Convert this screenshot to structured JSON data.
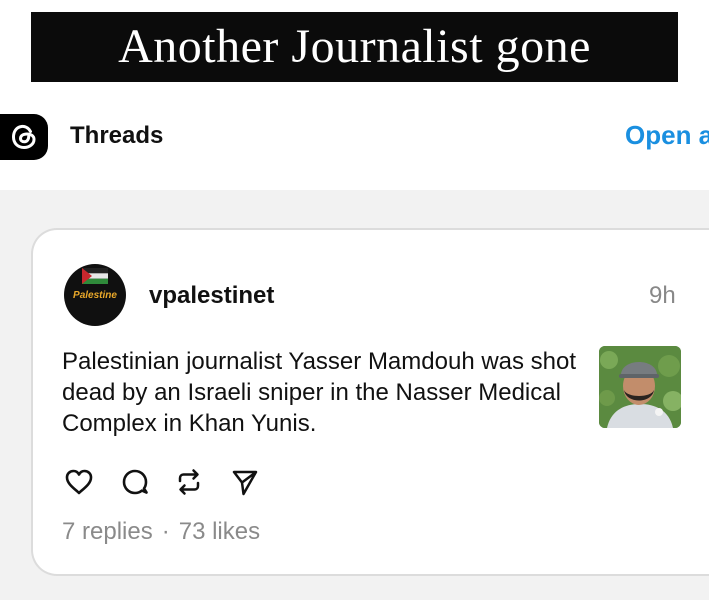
{
  "caption": {
    "text": "Another Journalist gone"
  },
  "header": {
    "app_name": "Threads",
    "open_link": "Open a"
  },
  "post": {
    "avatar_text": "Palestine",
    "username": "vpalestinet",
    "time": "9h",
    "text": "Palestinian journalist Yasser Mamdouh was shot dead by an Israeli sniper in the Nasser Medical Complex in Khan Yunis.",
    "replies": "7 replies",
    "separator": "·",
    "likes": "73 likes"
  },
  "icons": {
    "logo": "threads-logo-icon",
    "like": "heart-icon",
    "reply": "comment-icon",
    "repost": "repost-icon",
    "share": "send-icon"
  },
  "colors": {
    "caption_bg": "#0b0b0b",
    "link": "#1a8fe0",
    "muted_text": "#8a8a8a",
    "page_bg": "#f2f2f2"
  }
}
